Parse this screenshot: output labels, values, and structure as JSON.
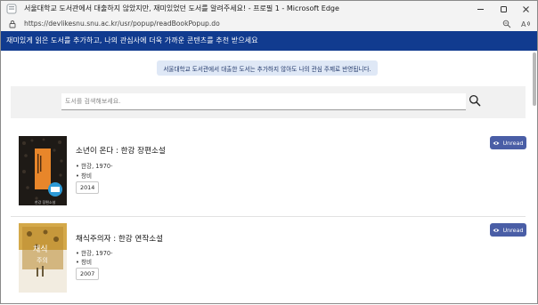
{
  "window": {
    "title": "서울대학교 도서관에서 대출하지 않았지만, 재미있었던 도서를 알려주세요! - 프로필 1 - Microsoft Edge",
    "url": "https://devlikesnu.snu.ac.kr/usr/popup/readBookPopup.do"
  },
  "banner": {
    "text": "재미있게 읽은 도서를 추가하고, 나의 관심사에 더욱 가까운 콘텐츠를 추천 받으세요"
  },
  "notice": {
    "text": "서울대학교 도서관에서 대출한 도서는 추가하지 않아도 나의 관심 주제로 반영됩니다."
  },
  "search": {
    "placeholder": "도서를 검색해보세요."
  },
  "books": [
    {
      "title": "소년이 온다 : 한강 장편소설",
      "author": "• 한강, 1970-",
      "publisher": "• 창비",
      "year": "2014",
      "status_label": "Unread"
    },
    {
      "title": "채식주의자 : 한강 연작소설",
      "author": "• 한강, 1970-",
      "publisher": "• 창비",
      "year": "2007",
      "status_label": "Unread"
    }
  ],
  "icons": {
    "app": "edge-page-icon",
    "lock": "lock-icon",
    "minimize": "minimize-icon",
    "maximize": "maximize-icon",
    "close": "close-icon",
    "zoom": "zoom-icon",
    "read_aloud": "read-aloud-icon",
    "search": "search-icon",
    "eye": "eye-icon"
  },
  "colors": {
    "banner": "#113b8f",
    "notice_bg": "#dfe8f6",
    "unread_button": "#4a5ea6"
  }
}
